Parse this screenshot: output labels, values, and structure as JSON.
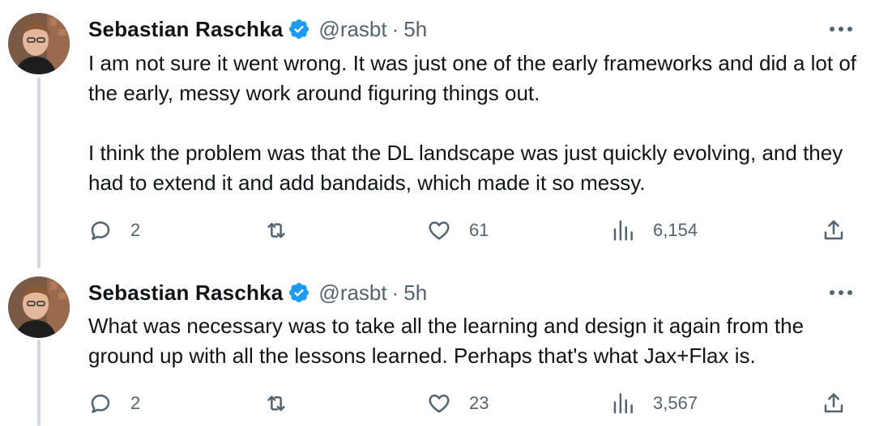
{
  "tweets": [
    {
      "author": {
        "display_name": "Sebastian Raschka",
        "handle": "@rasbt",
        "separator": "·",
        "time": "5h"
      },
      "paragraphs": [
        "I am not sure it went wrong. It was just one of the early frameworks and did a lot of the early, messy work around figuring things out.",
        "I think the problem was that the DL landscape was just quickly evolving, and they had to extend it and add bandaids, which made it so messy."
      ],
      "stats": {
        "replies": "2",
        "likes": "61",
        "views": "6,154"
      }
    },
    {
      "author": {
        "display_name": "Sebastian Raschka",
        "handle": "@rasbt",
        "separator": "·",
        "time": "5h"
      },
      "paragraphs": [
        "What was necessary was to take all the learning and design it again from the ground up with all the lessons learned. Perhaps that's what Jax+Flax is."
      ],
      "stats": {
        "replies": "2",
        "likes": "23",
        "views": "3,567"
      }
    }
  ],
  "icons": {
    "reply": "reply-icon",
    "retweet": "retweet-icon",
    "like": "like-icon",
    "views": "views-icon",
    "share": "share-icon",
    "verified": "verified-badge-icon",
    "more": "more-options-icon"
  },
  "colors": {
    "text": "#0f1419",
    "muted": "#536471",
    "verified": "#1d9bf0",
    "thread_line": "#cfd9de"
  }
}
